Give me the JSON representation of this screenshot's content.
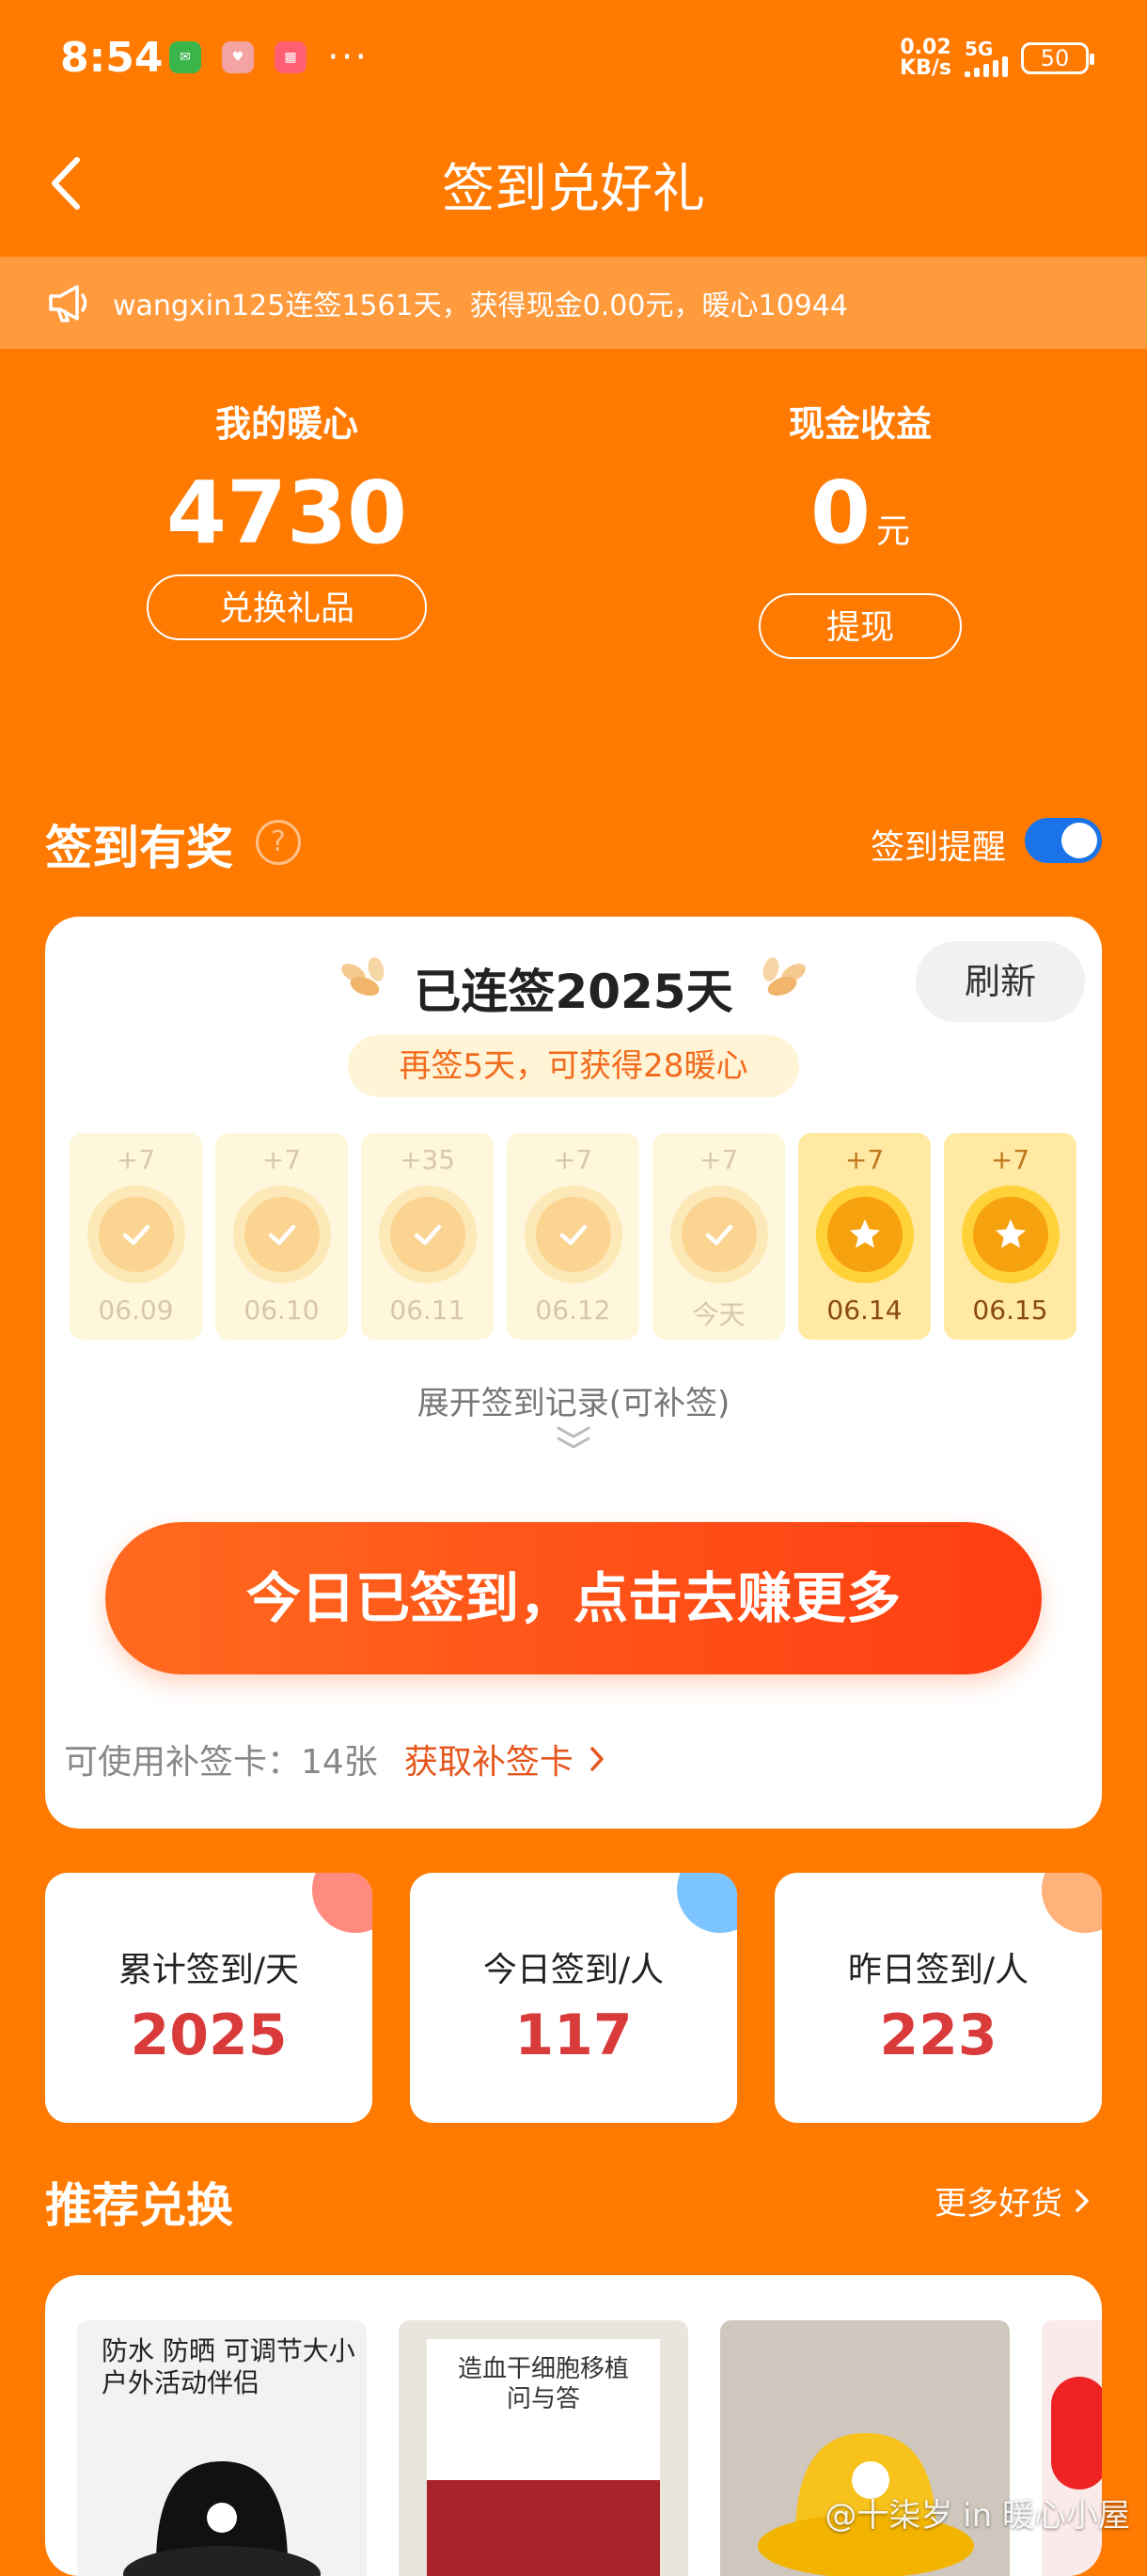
{
  "status_bar": {
    "time": "8:54",
    "netspeed_value": "0.02",
    "netspeed_unit": "KB/s",
    "network": "5G",
    "battery": "50",
    "more": "···"
  },
  "header": {
    "title": "签到兑好礼"
  },
  "notice": {
    "text": "wangxin125连签1561天，获得现金0.00元，暖心10944"
  },
  "stats": {
    "warmth": {
      "label": "我的暖心",
      "value": "4730",
      "button": "兑换礼品"
    },
    "cash": {
      "label": "现金收益",
      "value": "0",
      "unit": "元",
      "button": "提现"
    }
  },
  "checkin_section": {
    "title": "签到有奖",
    "help": "?",
    "reminder_label": "签到提醒",
    "reminder_on": true
  },
  "checkin_card": {
    "streak": "已连签2025天",
    "refresh": "刷新",
    "bonus": "再签5天，可获得28暖心",
    "days": [
      {
        "plus": "+7",
        "date": "06.09",
        "state": "done"
      },
      {
        "plus": "+7",
        "date": "06.10",
        "state": "done"
      },
      {
        "plus": "+35",
        "date": "06.11",
        "state": "done"
      },
      {
        "plus": "+7",
        "date": "06.12",
        "state": "done"
      },
      {
        "plus": "+7",
        "date": "今天",
        "state": "done"
      },
      {
        "plus": "+7",
        "date": "06.14",
        "state": "future"
      },
      {
        "plus": "+7",
        "date": "06.15",
        "state": "future"
      }
    ],
    "expand": "展开签到记录(可补签)",
    "cta": "今日已签到，点击去赚更多",
    "makeup_count": "可使用补签卡：14张",
    "makeup_link": "获取补签卡"
  },
  "mini_stats": [
    {
      "label": "累计签到/天",
      "value": "2025",
      "corner": "#ff8a80"
    },
    {
      "label": "今日签到/人",
      "value": "117",
      "corner": "#7cc4ff"
    },
    {
      "label": "昨日签到/人",
      "value": "223",
      "corner": "#ffb27a"
    }
  ],
  "recommend": {
    "title": "推荐兑换",
    "more": "更多好货",
    "products": [
      {
        "caption": "防水 防晒 可调节大小\n户外活动伴侣"
      },
      {
        "caption": "造血干细胞移植\n问与答"
      },
      {
        "caption": ""
      }
    ]
  },
  "watermark": "@十柒岁 in 暖心小屋",
  "colors": {
    "background": "#ff7a00",
    "accent": "#ff4e14",
    "value_red": "#d93a3a",
    "toggle_blue": "#1a73e8"
  }
}
